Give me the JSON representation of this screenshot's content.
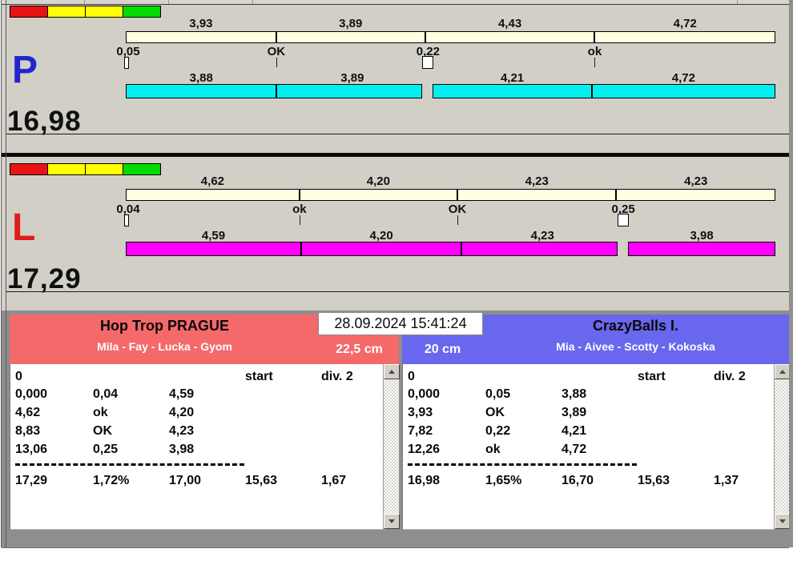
{
  "datetime": "28.09.2024 15:41:24",
  "colors": {
    "window_bg": "#D2CFC7",
    "bottom_bg": "#8E8E8E",
    "upper_bar": "#FFFFE1",
    "lane_p_bar": "#00F0F0",
    "lane_l_bar": "#FF00FF",
    "left_header": "#F4696A",
    "right_header": "#6967EE"
  },
  "lanes": [
    {
      "id": "P",
      "letter": "P",
      "letter_color": "#2424CE",
      "total": "16,98",
      "bar_color": "#00F0F0",
      "status_colors": [
        "#E81414",
        "#FFFF00",
        "#FFFF00",
        "#00DC00"
      ],
      "upper_segments": [
        {
          "value": 3.93,
          "label": "3,93"
        },
        {
          "value": 3.89,
          "label": "3,89"
        },
        {
          "value": 4.43,
          "label": "4,43"
        },
        {
          "value": 4.72,
          "label": "4,72"
        }
      ],
      "markers": [
        {
          "type": "start",
          "label": "0,05"
        },
        {
          "type": "tick",
          "label": "OK"
        },
        {
          "type": "checkbox",
          "label": "0,22"
        },
        {
          "type": "tick",
          "label": "ok"
        }
      ],
      "lower_segments": [
        {
          "value": 3.88,
          "label": "3,88"
        },
        {
          "value": 3.89,
          "label": "3,89"
        },
        {
          "value": 4.21,
          "label": "4,21"
        },
        {
          "value": 4.72,
          "label": "4,72"
        }
      ]
    },
    {
      "id": "L",
      "letter": "L",
      "letter_color": "#E11B1B",
      "total": "17,29",
      "bar_color": "#FF00FF",
      "status_colors": [
        "#E81414",
        "#FFFF00",
        "#FFFF00",
        "#00DC00"
      ],
      "upper_segments": [
        {
          "value": 4.62,
          "label": "4,62"
        },
        {
          "value": 4.2,
          "label": "4,20"
        },
        {
          "value": 4.23,
          "label": "4,23"
        },
        {
          "value": 4.23,
          "label": "4,23"
        }
      ],
      "markers": [
        {
          "type": "start",
          "label": "0,04"
        },
        {
          "type": "tick",
          "label": "ok"
        },
        {
          "type": "tick",
          "label": "OK"
        },
        {
          "type": "checkbox",
          "label": "0,25"
        }
      ],
      "lower_segments": [
        {
          "value": 4.59,
          "label": "4,59"
        },
        {
          "value": 4.2,
          "label": "4,20"
        },
        {
          "value": 4.23,
          "label": "4,23"
        },
        {
          "value": 3.98,
          "label": "3,98"
        }
      ]
    }
  ],
  "teams": [
    {
      "name": "Hop Trop PRAGUE",
      "members": "Mila - Fay - Lucka - Gyom",
      "size": "22,5 cm",
      "header_color": "#F4696A",
      "table": {
        "header_row": [
          "0",
          "",
          "",
          "start",
          "div. 2"
        ],
        "rows": [
          [
            "0,000",
            "0,04",
            "4,59"
          ],
          [
            "4,62",
            "ok",
            "4,20"
          ],
          [
            "8,83",
            "OK",
            "4,23"
          ],
          [
            "13,06",
            "0,25",
            "3,98"
          ]
        ],
        "totals": [
          "17,29",
          "1,72%",
          "17,00",
          "15,63",
          "1,67"
        ]
      }
    },
    {
      "name": "CrazyBalls I.",
      "members": "Mia - Aivee - Scotty - Kokoska",
      "size": "20 cm",
      "header_color": "#6967EE",
      "table": {
        "header_row": [
          "0",
          "",
          "",
          "start",
          "div. 2"
        ],
        "rows": [
          [
            "0,000",
            "0,05",
            "3,88"
          ],
          [
            "3,93",
            "OK",
            "3,89"
          ],
          [
            "7,82",
            "0,22",
            "4,21"
          ],
          [
            "12,26",
            "ok",
            "4,72"
          ]
        ],
        "totals": [
          "16,98",
          "1,65%",
          "16,70",
          "15,63",
          "1,37"
        ]
      }
    }
  ]
}
